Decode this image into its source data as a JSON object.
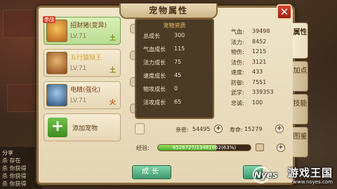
{
  "dialog": {
    "title": "宠物属性",
    "close_label": "✕"
  },
  "pets": [
    {
      "name": "招财猪(变异)",
      "level": "LV.71",
      "element": "土",
      "tag": "参战",
      "selected": true
    },
    {
      "name": "五行猿狱王",
      "level": "LV.71",
      "element": "土",
      "selected": false
    },
    {
      "name": "电精(强化)",
      "level": "LV.71",
      "element": "火",
      "selected": false
    }
  ],
  "add_pet_label": "添加宠物",
  "growth": {
    "header": "宠物资质",
    "rows": [
      {
        "label": "总成长",
        "value": "300"
      },
      {
        "label": "气血成长",
        "value": "115"
      },
      {
        "label": "法力成长",
        "value": "75"
      },
      {
        "label": "速度成长",
        "value": "45"
      },
      {
        "label": "物攻成长",
        "value": "0"
      },
      {
        "label": "法攻成长",
        "value": "65"
      }
    ]
  },
  "stats": [
    {
      "label": "气血:",
      "value": "39498"
    },
    {
      "label": "法力:",
      "value": "8452"
    },
    {
      "label": "物伤:",
      "value": "1215"
    },
    {
      "label": "法伤:",
      "value": "3121"
    },
    {
      "label": "速度:",
      "value": "433"
    },
    {
      "label": "防御:",
      "value": "7551"
    },
    {
      "label": "武学:",
      "value": "339353"
    },
    {
      "label": "忠诚:",
      "value": "100"
    }
  ],
  "tabs": [
    "属性",
    "加点",
    "技能",
    "图鉴"
  ],
  "intimacy": {
    "label": "亲密:",
    "value": "54495"
  },
  "lifespan": {
    "label": "寿命:",
    "value": "15279"
  },
  "exp": {
    "label": "经验:",
    "text": "8526727/13481662(63%)",
    "percent": 63
  },
  "grow_button_label": "成长",
  "chat_lines": [
    "分享",
    "杀 存在",
    "杀 你获得",
    "杀 你获得",
    "杀 你获得"
  ],
  "watermark": {
    "title": "游戏王国",
    "url": "www.noyes.com",
    "logo": "Nyes"
  },
  "colors": {
    "panel_bg": "#efe4c9",
    "border": "#8a6a3e",
    "selected_item": "#b9dc92",
    "exp_fill": "#4aa22a"
  }
}
